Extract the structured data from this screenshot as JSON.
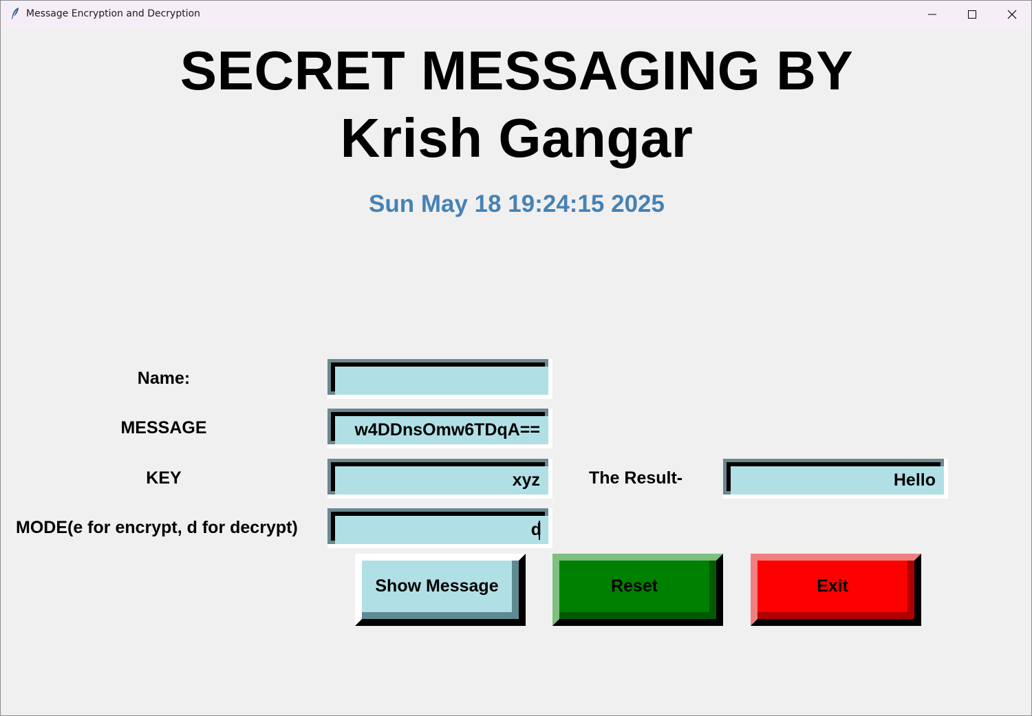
{
  "window": {
    "title": "Message Encryption and Decryption",
    "icon": "feather-icon"
  },
  "header": {
    "line1": "SECRET MESSAGING BY",
    "line2": "Krish Gangar",
    "datetime": "Sun May 18 19:24:15 2025"
  },
  "form": {
    "name_label": "Name:",
    "name_value": "",
    "message_label": "MESSAGE",
    "message_value": "w4DDnsOmw6TDqA==",
    "key_label": "KEY",
    "key_value": "xyz",
    "mode_label": "MODE(e for encrypt, d for decrypt)",
    "mode_value": "d",
    "result_label": "The Result-",
    "result_value": "Hello"
  },
  "buttons": {
    "show": "Show Message",
    "reset": "Reset",
    "exit": "Exit"
  },
  "colors": {
    "datetime": "#4682b4",
    "entry_bg": "#b0e0e6",
    "reset_bg": "#008000",
    "exit_bg": "#ff0000"
  }
}
